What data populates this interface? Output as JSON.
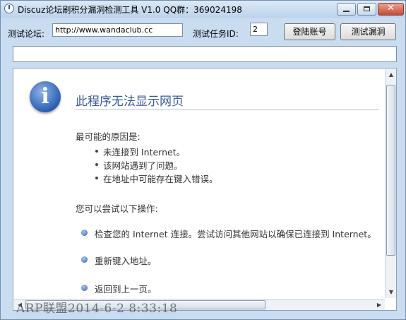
{
  "window": {
    "title": "Discuz论坛刷积分漏洞检测工具 V1.0   QQ群：369024198",
    "minimize": "minimize",
    "maximize": "maximize",
    "close_glyph": "✕"
  },
  "toolbar": {
    "forum_label": "测试论坛:",
    "forum_url": "http://www.wandaclub.cc",
    "task_label": "测试任务ID:",
    "task_id": "2",
    "login_button": "登陆账号",
    "test_button": "测试漏洞",
    "address_value": ""
  },
  "browser": {
    "icon": "info-icon",
    "icon_glyph": "i",
    "title": "此程序无法显示网页",
    "reasons_heading": "最可能的原因是:",
    "reasons": [
      "未连接到 Internet。",
      "该网站遇到了问题。",
      "在地址中可能存在键入错误。"
    ],
    "actions_heading": "您可以尝试以下操作:",
    "actions": [
      "检查您的 Internet 连接。尝试访问其他网站以确保已连接到 Internet。",
      "重新键入地址。",
      "返回到上一页。"
    ],
    "scroll_up": "▲",
    "scroll_down": "▼",
    "scroll_left": "◀",
    "scroll_right": "▶"
  },
  "watermark": "ARP联盟2014-6-2 8:33:18",
  "colors": {
    "title_blue": "#3b5a95",
    "frame": "#c9dcf0",
    "close_red": "#c44a32"
  }
}
